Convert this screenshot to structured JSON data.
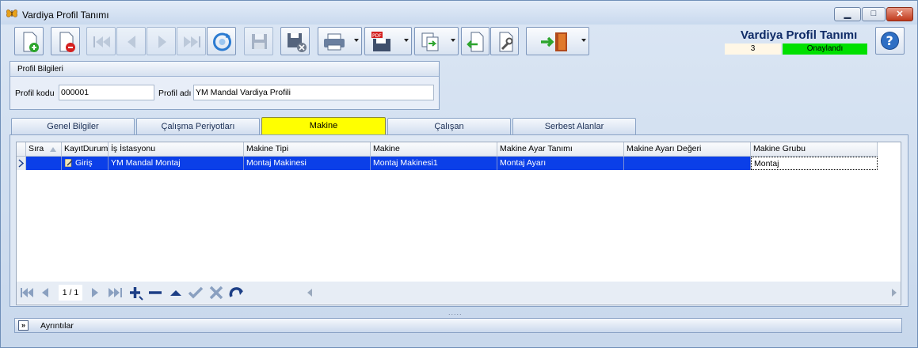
{
  "window": {
    "title": "Vardiya Profil Tanımı"
  },
  "header": {
    "title": "Vardiya Profil Tanımı",
    "record_count": "3",
    "status": "Onaylandı"
  },
  "toolbar": {
    "icons": [
      "new-record-icon",
      "delete-record-icon",
      "first-record-icon",
      "previous-record-icon",
      "next-record-icon",
      "last-record-icon",
      "refresh-icon",
      "save-icon",
      "save-close-icon",
      "print-icon",
      "pdf-export-icon",
      "copy-icon",
      "import-icon",
      "settings-icon",
      "exit-icon"
    ]
  },
  "profile": {
    "group_title": "Profil Bilgileri",
    "code_label": "Profil kodu",
    "code_value": "000001",
    "name_label": "Profil adı",
    "name_value": "YM Mandal Vardiya Profili"
  },
  "tabs": [
    {
      "label": "Genel Bilgiler"
    },
    {
      "label": "Çalışma Periyotları"
    },
    {
      "label": "Makine"
    },
    {
      "label": "Çalışan"
    },
    {
      "label": "Serbest Alanlar"
    }
  ],
  "grid": {
    "columns": [
      "Sıra",
      "KayıtDurum",
      "İş İstasyonu",
      "Makine Tipi",
      "Makine",
      "Makine Ayar Tanımı",
      "Makine Ayarı Değeri",
      "Makine Grubu"
    ],
    "rows": [
      {
        "sira": "",
        "kayit_durum": "Giriş",
        "is_istasyonu": "YM Mandal Montaj",
        "makine_tipi": "Montaj Makinesi",
        "makine": "Montaj Makinesi1",
        "ayar_tanimi": "Montaj Ayarı",
        "ayar_degeri": "",
        "makine_grubu": "Montaj"
      }
    ]
  },
  "navigator": {
    "page": "1 / 1"
  },
  "details": {
    "label": "Ayrıntılar"
  },
  "colors": {
    "accent": "#0b3fe8",
    "status_ok": "#00e000",
    "active_tab": "#ffff00"
  }
}
